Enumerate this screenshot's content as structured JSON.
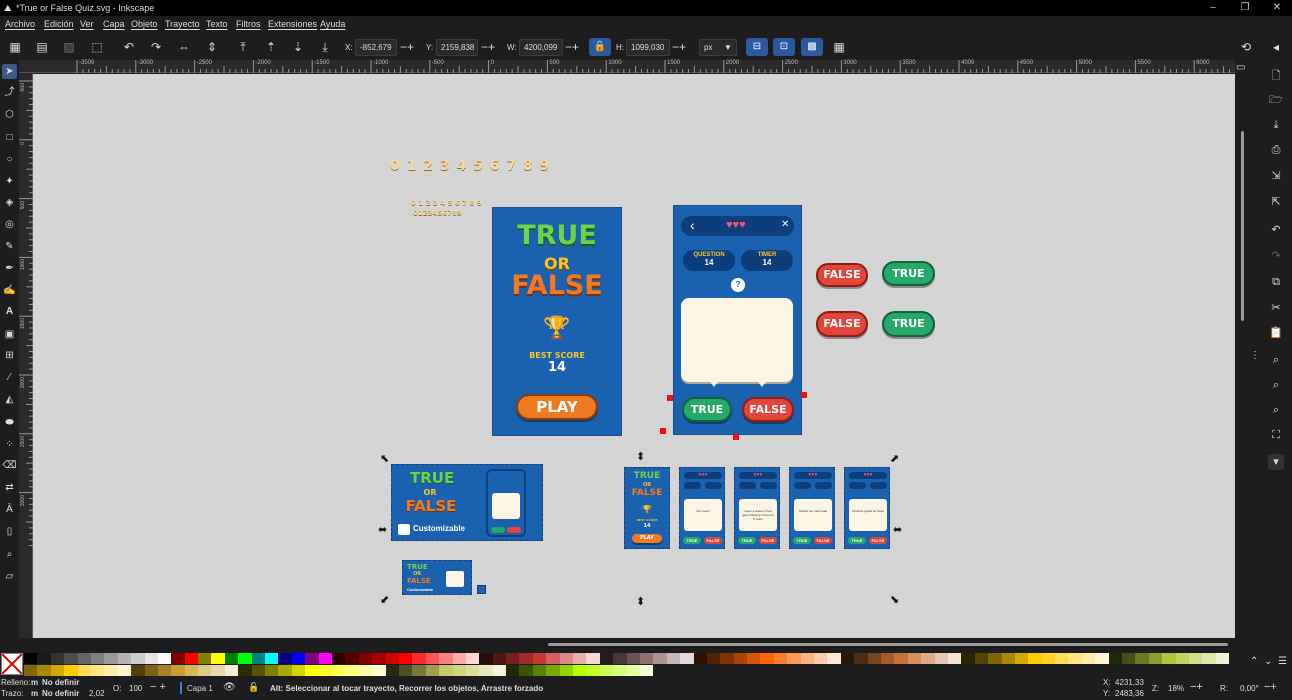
{
  "window": {
    "title": "*True or False Quiz.svg - Inkscape",
    "minimize": "‒",
    "maximize": "❐",
    "close": "✕"
  },
  "menu": [
    "Archivo",
    "Edición",
    "Ver",
    "Capa",
    "Objeto",
    "Trayecto",
    "Texto",
    "Filtros",
    "Extensiones",
    "Ayuda"
  ],
  "toolbar": {
    "x_label": "X:",
    "x_value": "-852,679",
    "y_label": "Y:",
    "y_value": "2159,838",
    "w_label": "W:",
    "w_value": "4200,099",
    "h_label": "H:",
    "h_value": "1099,030",
    "unit": "px"
  },
  "ruler_h": [
    "-3500",
    "-3000",
    "-2500",
    "-2000",
    "-1500",
    "-1000",
    "-500",
    "0",
    "500",
    "1000",
    "1500",
    "2000",
    "2500",
    "3000",
    "3500",
    "4000",
    "4500",
    "5000",
    "5500",
    "6000"
  ],
  "ruler_v": [
    "-500",
    "0",
    "500",
    "1000",
    "1500",
    "2000",
    "2500",
    "3000"
  ],
  "canvas": {
    "digits_large": "0 1 2 3 4 5 6 7 8 9",
    "digits_small_1": "0 1 2 3 4 5 6 7 8 9",
    "digits_small_2": "0123456789",
    "title_screen": {
      "line1": "TRUE",
      "line2": "OR",
      "line3": "FALSE",
      "trophy": "🏆",
      "best_label": "BEST SCORE",
      "best_value": "14",
      "play": "PLAY"
    },
    "quiz_screen": {
      "back": "‹",
      "hearts": "♥♥♥",
      "close": "✕",
      "question_label": "QUESTION",
      "question_value": "14",
      "timer_label": "TIMER",
      "timer_value": "14",
      "help": "?",
      "true_btn": "TRUE",
      "false_btn": "FALSE"
    },
    "buttons": {
      "false1": "FALSE",
      "true1": "TRUE",
      "false2": "FALSE",
      "true2": "TRUE"
    },
    "banner": {
      "line1": "TRUE",
      "line2": "OR",
      "line3": "FALSE",
      "customizable": "Customizable"
    },
    "thumbs": [
      {
        "kind": "title",
        "t1": "TRUE",
        "t2": "OR",
        "t3": "FALSE",
        "best": "BEST SCORE",
        "score": "14",
        "play": "PLAY"
      },
      {
        "kind": "quiz",
        "text": "Sun rises!",
        "true": "TRUE",
        "false": "FALSE"
      },
      {
        "kind": "quiz",
        "text": "Learn a lesson! Over gaze thinking it hurts for 5 years",
        "true": "TRUE",
        "false": "FALSE"
      },
      {
        "kind": "quiz",
        "text": "Sharks are mammals",
        "true": "TRUE",
        "false": "FALSE"
      },
      {
        "kind": "quiz",
        "text": "Octopus grows an heart",
        "true": "TRUE",
        "false": "FALSE"
      }
    ]
  },
  "status": {
    "fill_label": "Relleno:",
    "fill_m": "m",
    "fill_value": "No definir",
    "stroke_label": "Trazo:",
    "stroke_m": "m",
    "stroke_value": "No definir",
    "stroke_width": "2,02",
    "opacity_label": "O:",
    "opacity_value": "100",
    "layer": "Capa 1",
    "message": "Alt: Seleccionar al tocar trayecto, Recorrer los objetos, Arrastre forzado",
    "x_label": "X:",
    "x_value": "4231,33",
    "y_label": "Y:",
    "y_value": "2483,36",
    "zoom_label": "Z:",
    "zoom_value": "18%",
    "rot_label": "R:",
    "rot_value": "0,00°"
  },
  "palette_colors": [
    "#000000",
    "#1a1a1a",
    "#333333",
    "#4d4d4d",
    "#666666",
    "#808080",
    "#999999",
    "#b3b3b3",
    "#cccccc",
    "#e6e6e6",
    "#ffffff",
    "#800000",
    "#ff0000",
    "#808000",
    "#ffff00",
    "#008000",
    "#00ff00",
    "#008080",
    "#00ffff",
    "#000080",
    "#0000ff",
    "#800080",
    "#ff00ff",
    "#2b0000",
    "#550000",
    "#800000",
    "#aa0000",
    "#d40000",
    "#ff0000",
    "#ff2a2a",
    "#ff5555",
    "#ff8080",
    "#ffaaaa",
    "#ffd5d5",
    "#280b0b",
    "#501616",
    "#782121",
    "#a02c2c",
    "#c83737",
    "#d35f5f",
    "#de8787",
    "#e9afaf",
    "#f4d7d7",
    "#241c1c",
    "#483737",
    "#6c5353",
    "#916f6f",
    "#ac9393",
    "#c8b7b7",
    "#e3dbdb",
    "#2b1100",
    "#552200",
    "#803300",
    "#aa4400",
    "#d45500",
    "#ff6600",
    "#ff7f2a",
    "#ff9955",
    "#ffb380",
    "#ffccaa",
    "#ffe6d5",
    "#28170b",
    "#502d16",
    "#784421",
    "#a05a2c",
    "#c87137",
    "#d38d5f",
    "#deaa87",
    "#e9c6af",
    "#f4e3d7",
    "#2b2200",
    "#554400",
    "#806600",
    "#aa8800",
    "#d4aa00",
    "#ffcc00",
    "#ffd42a",
    "#ffdd55",
    "#ffe680",
    "#ffeeaa",
    "#fff6d5",
    "#22280b",
    "#445016",
    "#677821",
    "#89a02c",
    "#abc837",
    "#bcd35f",
    "#cdde87",
    "#dde9af",
    "#eef4d7"
  ],
  "palette_colors_row2": [
    "#806600",
    "#aa8800",
    "#d4aa00",
    "#ffcc00",
    "#ffdd55",
    "#ffe680",
    "#ffeeaa",
    "#fff6d5",
    "#55400d",
    "#806019",
    "#aa8026",
    "#c8a032",
    "#d4b855",
    "#deca87",
    "#e9d8af",
    "#f4ecd7",
    "#2b2b00",
    "#555500",
    "#808000",
    "#aaaa00",
    "#d4d400",
    "#ffff00",
    "#ffff2a",
    "#ffff55",
    "#ffff80",
    "#ffffaa",
    "#ffffd5",
    "#282816",
    "#505028",
    "#787839",
    "#a0a04b",
    "#c8c864",
    "#d3d37f",
    "#dede9e",
    "#e9e9be",
    "#f4f4dd",
    "#1e2b00",
    "#3c5500",
    "#5a8000",
    "#78aa00",
    "#96d400",
    "#b4ff00",
    "#c0ff2a",
    "#cdff55",
    "#d9ff80",
    "#e6ffaa",
    "#f2ffd5"
  ]
}
